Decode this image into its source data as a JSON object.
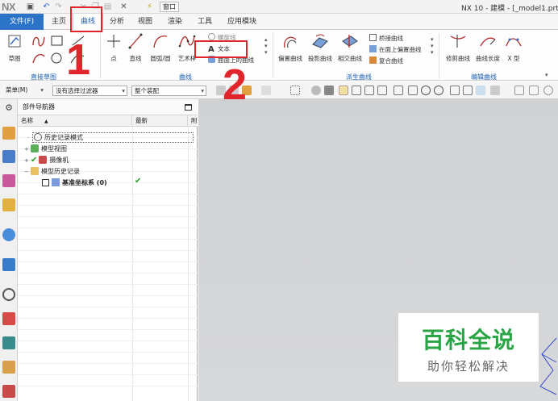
{
  "titlebar": {
    "logo": "NX",
    "window_menu": "窗口",
    "title": "NX 10 - 建模 - [_model1.prt"
  },
  "tabs": {
    "file": "文件(F)",
    "items": [
      "主页",
      "曲线",
      "分析",
      "视图",
      "渲染",
      "工具",
      "应用模块"
    ],
    "active": "曲线"
  },
  "ribbon": {
    "sketch_label": "草图",
    "direct_sketch_group": "直接草图",
    "point_label": "点",
    "line_label": "直线",
    "arc_label": "圆弧/圆",
    "artistic_label": "艺术样",
    "curve_menu": {
      "item1": "螺旋线",
      "item2": "文本",
      "item3": "曲面上的曲线"
    },
    "curve_group": "曲线",
    "offset_curve": "偏置曲线",
    "project_curve": "投影曲线",
    "intersect_curve": "相交曲线",
    "bridge_curve": "桥接曲线",
    "offset_on_face": "在面上偏置曲线",
    "composite_curve": "复合曲线",
    "derived_group": "派生曲线",
    "trim_curve": "修剪曲线",
    "curve_length": "曲线长度",
    "x_type": "X 型",
    "edit_group": "编辑曲线"
  },
  "selbar": {
    "menu": "菜单(M)",
    "filter": "没有选择过滤器",
    "scope": "整个装配"
  },
  "navigator": {
    "title": "部件导航器",
    "col_name": "名称",
    "col_latest": "最新",
    "col_extra": "附",
    "nodes": [
      {
        "label": "历史记录模式"
      },
      {
        "label": "模型视图"
      },
      {
        "label": "摄像机"
      },
      {
        "label": "模型历史记录"
      },
      {
        "label": "基准坐标系 (0)"
      }
    ]
  },
  "annotations": {
    "step1": "1",
    "step2": "2"
  },
  "watermark": {
    "title": "百科全说",
    "subtitle": "助你轻松解决"
  },
  "colors": {
    "accent": "#2b74c8",
    "annotation": "#e0262c",
    "watermark_green": "#2aa545",
    "check_green": "#2a9d2a"
  }
}
